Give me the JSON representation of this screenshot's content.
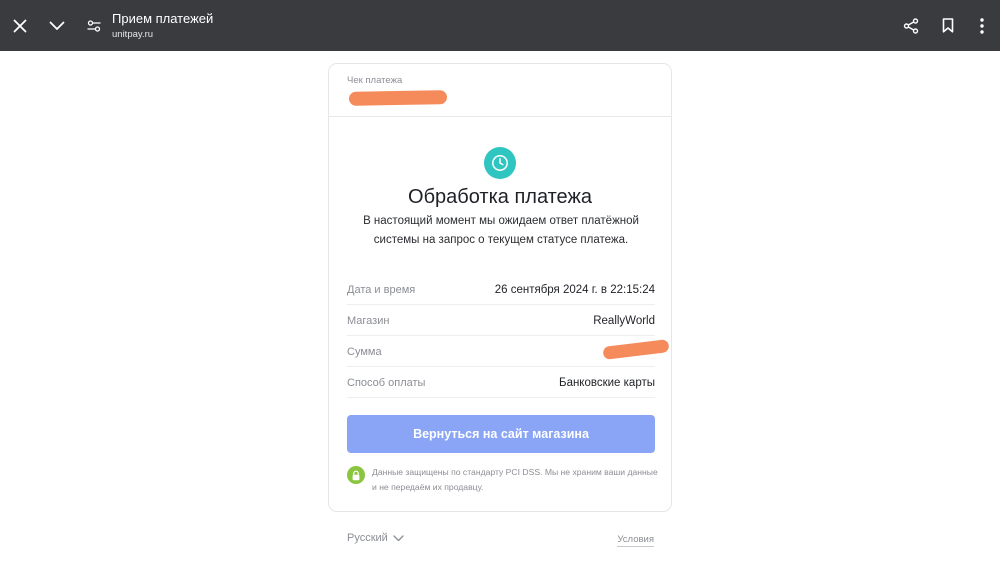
{
  "toolbar": {
    "title": "Прием платежей",
    "url": "unitpay.ru",
    "background": "#3a3b3f"
  },
  "receipt": {
    "label": "Чек платежа",
    "id": ""
  },
  "status": {
    "icon": "clock-icon",
    "icon_color": "#2fc5c0",
    "title": "Обработка платежа",
    "description": "В настоящий момент мы ожидаем ответ платёжной системы на запрос о текущем статусе платежа."
  },
  "details": [
    {
      "key": "Дата и время",
      "value": "26 сентября 2024 г. в 22:15:24"
    },
    {
      "key": "Магазин",
      "value": "ReallyWorld"
    },
    {
      "key": "Сумма",
      "value": ""
    },
    {
      "key": "Способ оплаты",
      "value": "Банковские карты"
    }
  ],
  "return_button": {
    "label": "Вернуться на сайт магазина",
    "color": "#8aa4f6"
  },
  "security": {
    "icon": "lock-icon",
    "icon_color": "#8bc53f",
    "text": "Данные защищены по стандарту PCI DSS. Мы не храним ваши данные и не передаём их продавцу."
  },
  "footer": {
    "language": "Русский",
    "terms": "Условия"
  },
  "redaction_color": "#f58a5b"
}
